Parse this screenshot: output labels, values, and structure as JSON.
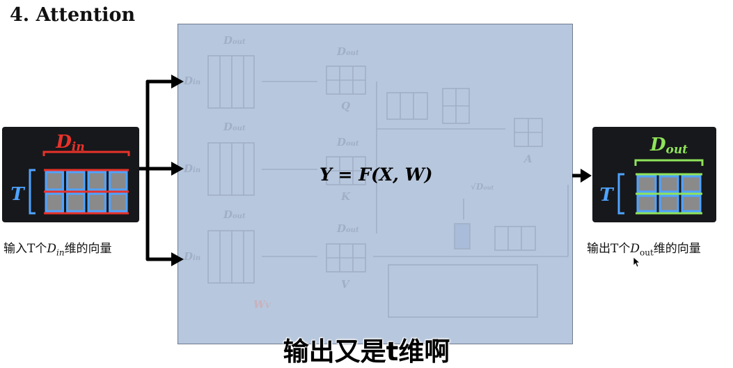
{
  "slide": {
    "title": "4. Attention",
    "formula": "Y = F(X, W)",
    "subtitle": "输出又是t维啊"
  },
  "input": {
    "caption_prefix": "输入T个",
    "caption_var": "D",
    "caption_sub": "in",
    "caption_suffix": "维的向量",
    "dim_label_var": "D",
    "dim_label_sub": "in",
    "row_label": "T",
    "matrix_rows": 2,
    "matrix_cols": 4,
    "accent_color": "#e8322a",
    "cell_color": "#4fa3ff"
  },
  "output": {
    "caption_prefix": "输出T个",
    "caption_var": "D",
    "caption_sub": "out",
    "caption_suffix": "维的向量",
    "dim_label_var": "D",
    "dim_label_sub": "out",
    "row_label": "T",
    "matrix_rows": 2,
    "matrix_cols": 3,
    "accent_color": "#8fe35a",
    "cell_color": "#4fa3ff"
  },
  "background_diagram": {
    "matrix_labels": [
      "D_out",
      "D_out",
      "D_out"
    ],
    "row_labels": [
      "D_in",
      "D_in",
      "D_in"
    ],
    "weight_labels": [
      "W_q",
      "W_k",
      "W_v"
    ],
    "result_labels": [
      "Q",
      "K",
      "V",
      "A"
    ]
  }
}
